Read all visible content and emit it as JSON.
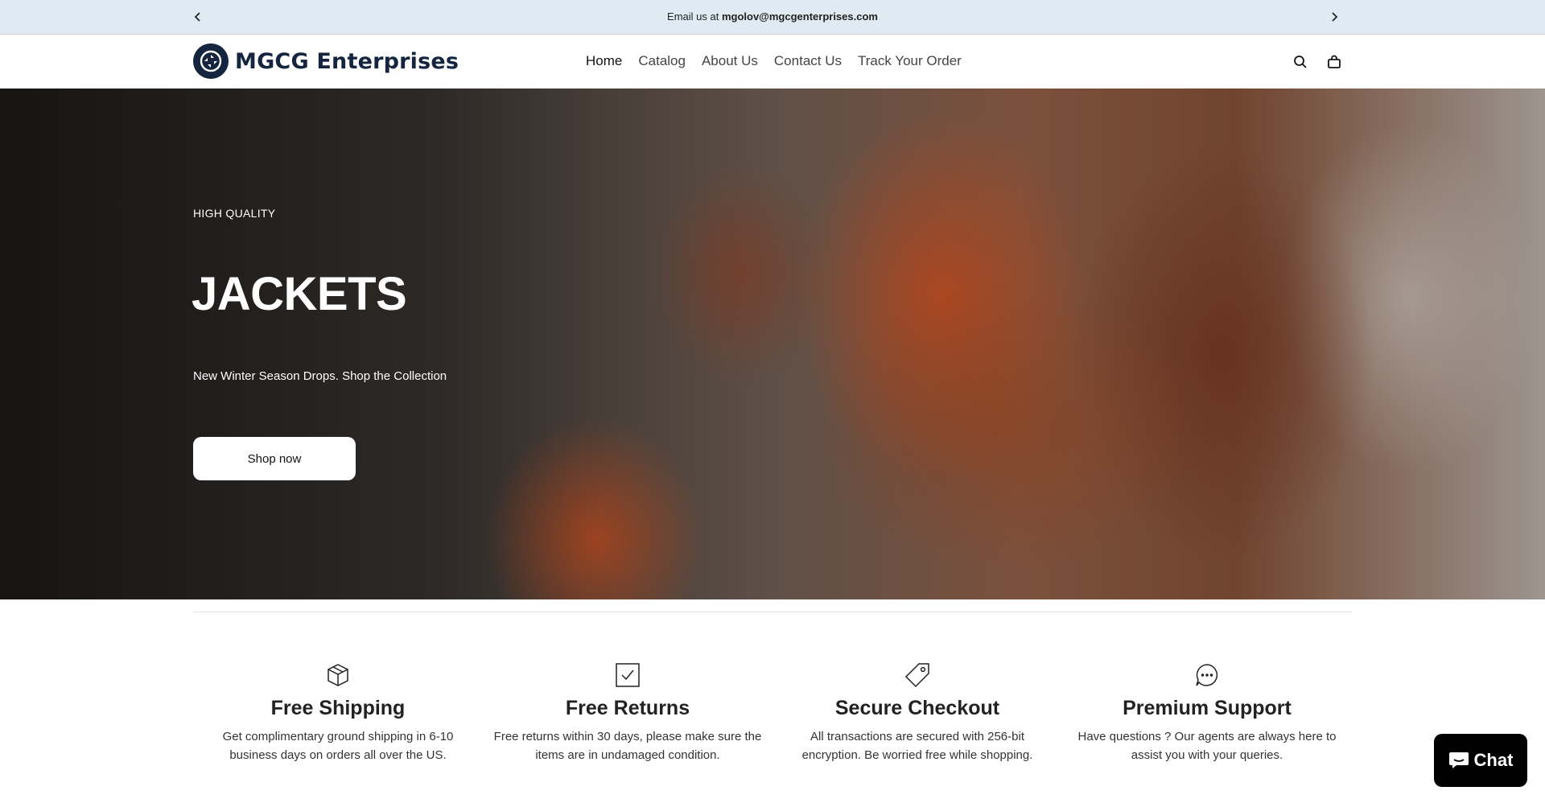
{
  "announcement": {
    "prefix": "Email us at ",
    "email": "mgolov@mgcgenterprises.com"
  },
  "header": {
    "brand": "MGCG Enterprises",
    "nav": [
      {
        "label": "Home",
        "active": true
      },
      {
        "label": "Catalog"
      },
      {
        "label": "About Us"
      },
      {
        "label": "Contact Us"
      },
      {
        "label": "Track Your Order"
      }
    ],
    "icons": [
      "search-icon",
      "cart-icon"
    ]
  },
  "hero": {
    "eyebrow": "HIGH QUALITY",
    "title": "JACKETS",
    "subtitle": "New Winter Season Drops. Shop the Collection",
    "button": "Shop now"
  },
  "features": [
    {
      "icon": "box-icon",
      "title": "Free Shipping",
      "text": "Get complimentary ground shipping in 6-10 business days on orders all over the US."
    },
    {
      "icon": "checkbox-icon",
      "title": "Free Returns",
      "text": "Free returns within 30 days, please make sure the items are in undamaged condition."
    },
    {
      "icon": "tag-icon",
      "title": "Secure Checkout",
      "text": "All transactions are secured with 256-bit encryption. Be worried free while shopping."
    },
    {
      "icon": "chat-bubble-icon",
      "title": "Premium Support",
      "text": "Have questions ? Our agents are always here to assist you with your queries."
    }
  ],
  "chat": {
    "label": "Chat"
  },
  "colors": {
    "announcement_bg": "#dfeaf3",
    "brand": "#15243f",
    "chat_bg": "#000000"
  }
}
